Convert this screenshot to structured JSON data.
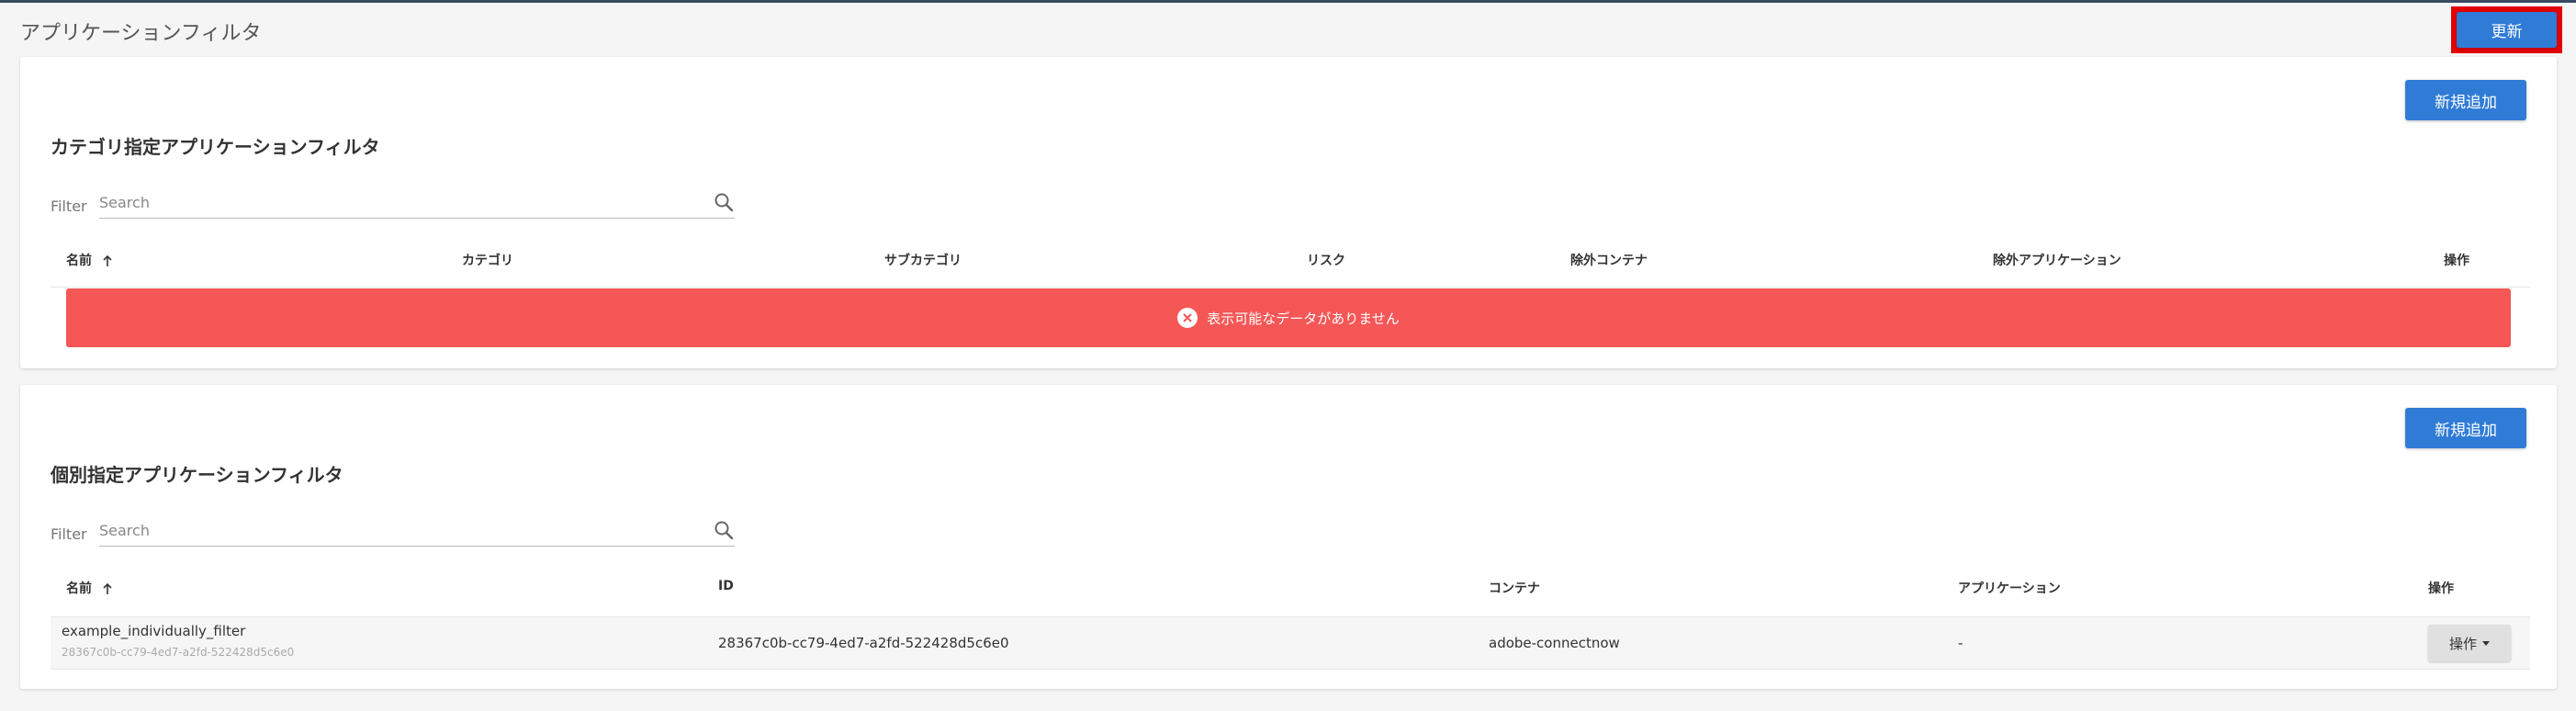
{
  "page": {
    "title": "アプリケーションフィルタ",
    "refresh_label": "更新"
  },
  "category_section": {
    "title": "カテゴリ指定アプリケーションフィルタ",
    "add_label": "新規追加",
    "filter_label": "Filter",
    "search_placeholder": "Search",
    "columns": [
      "名前",
      "カテゴリ",
      "サブカテゴリ",
      "リスク",
      "除外コンテナ",
      "除外アプリケーション",
      "操作"
    ],
    "empty_message": "表示可能なデータがありません"
  },
  "individual_section": {
    "title": "個別指定アプリケーションフィルタ",
    "add_label": "新規追加",
    "filter_label": "Filter",
    "search_placeholder": "Search",
    "columns": [
      "名前",
      "ID",
      "コンテナ",
      "アプリケーション",
      "操作"
    ],
    "rows": [
      {
        "name": "example_individually_filter",
        "name_sub": "28367c0b-cc79-4ed7-a2fd-522428d5c6e0",
        "id": "28367c0b-cc79-4ed7-a2fd-522428d5c6e0",
        "container": "adobe-connectnow",
        "application": "-",
        "action_label": "操作"
      }
    ]
  },
  "colors": {
    "primary": "#2f7bd6",
    "error": "#f55656",
    "highlight": "#e30000"
  },
  "icons": {
    "search": "search-icon",
    "sort": "arrow-up-icon",
    "error": "close-circle-icon",
    "dropdown": "caret-down-icon"
  }
}
